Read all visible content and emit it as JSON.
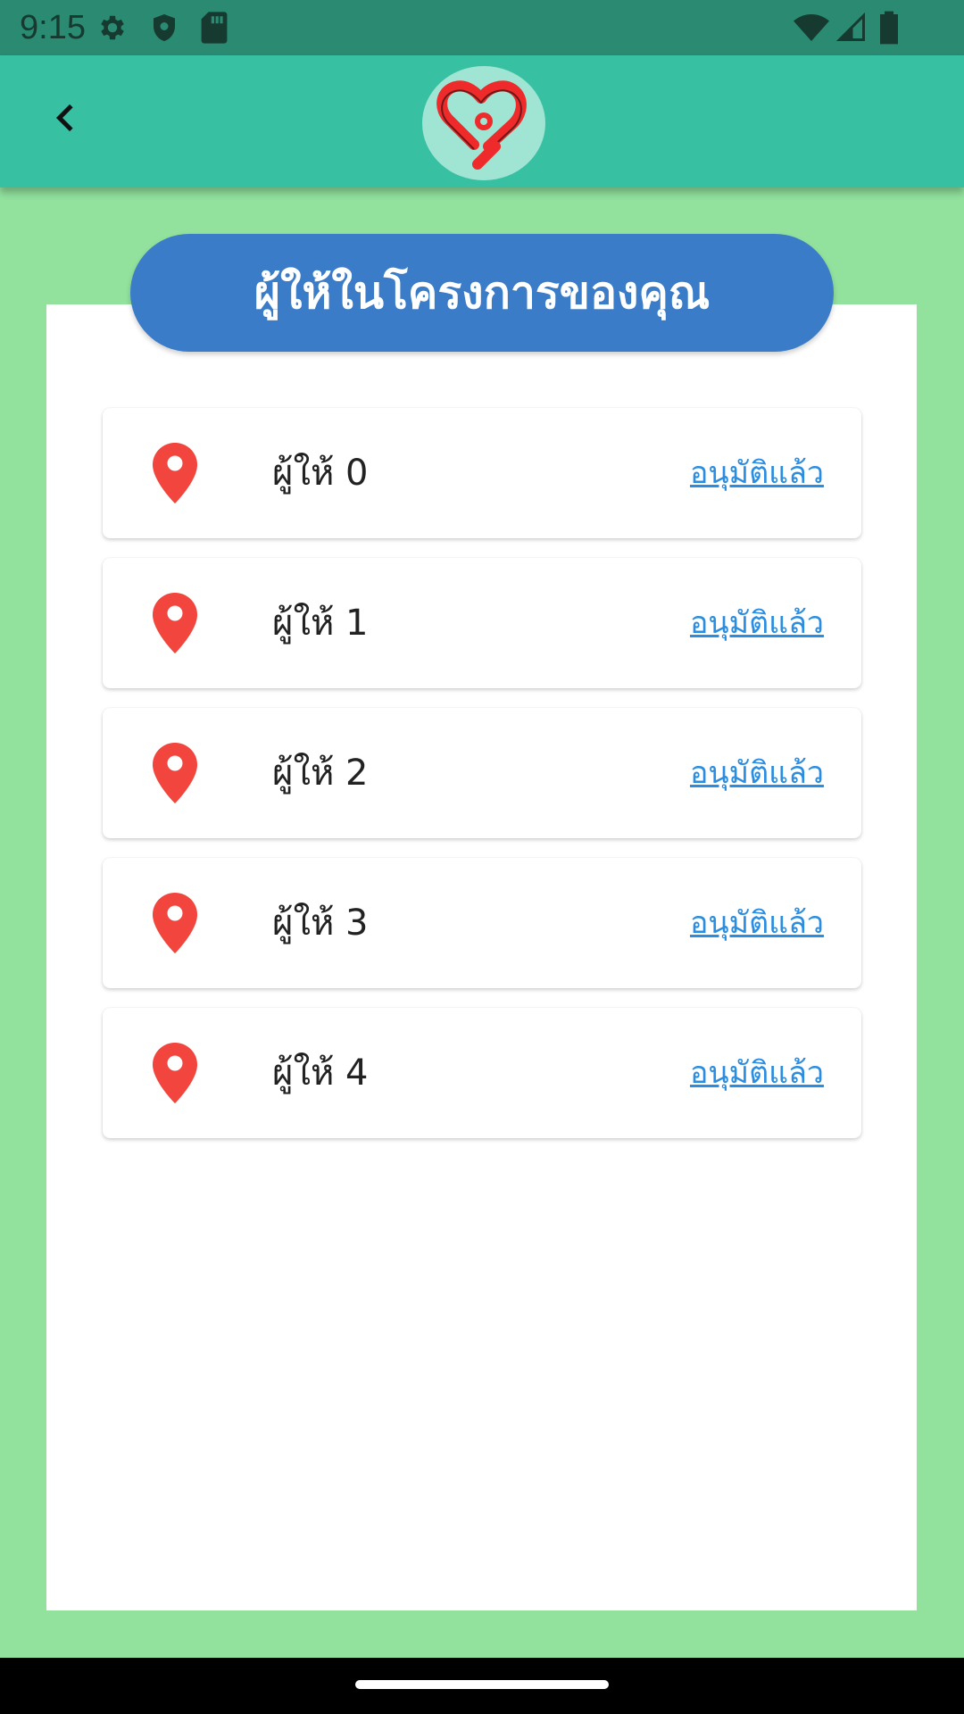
{
  "status_bar": {
    "time": "9:15",
    "icons": [
      "gear-icon",
      "shield-icon",
      "sd-card-icon",
      "wifi-icon",
      "signal-icon",
      "battery-icon"
    ]
  },
  "app_bar": {
    "back_icon": "chevron-left-icon",
    "logo": "heart-logo"
  },
  "title": "ผู้ให้ในโครงการของคุณ",
  "donors": [
    {
      "name": "ผู้ให้ 0",
      "status": "อนุมัติแล้ว"
    },
    {
      "name": "ผู้ให้ 1",
      "status": "อนุมัติแล้ว"
    },
    {
      "name": "ผู้ให้ 2",
      "status": "อนุมัติแล้ว"
    },
    {
      "name": "ผู้ให้ 3",
      "status": "อนุมัติแล้ว"
    },
    {
      "name": "ผู้ให้ 4",
      "status": "อนุมัติแล้ว"
    }
  ],
  "colors": {
    "background": "#92e29e",
    "app_bar": "#38c0a3",
    "status_bar": "#2a8a72",
    "title_pill": "#3a7cc7",
    "pin": "#f2453d",
    "link": "#2a8de0"
  }
}
